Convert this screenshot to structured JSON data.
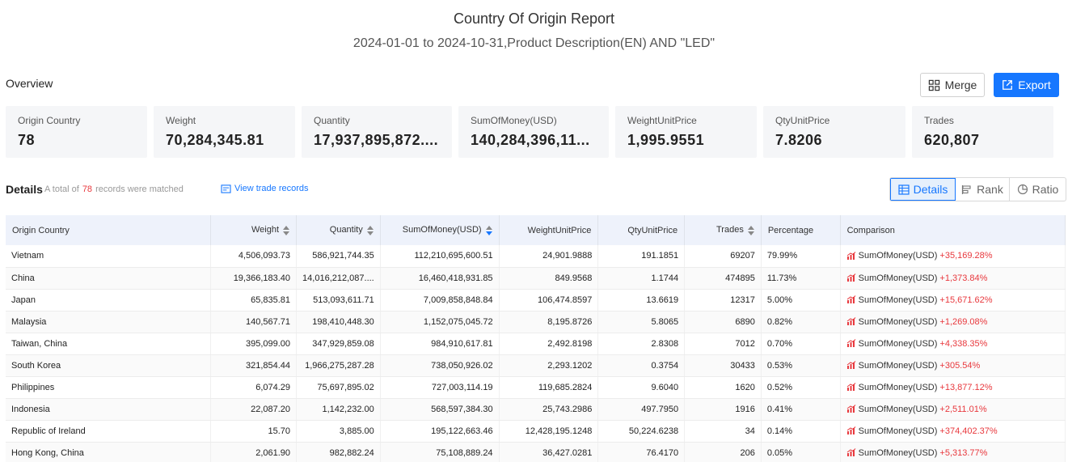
{
  "report": {
    "title": "Country Of Origin Report",
    "subtitle": "2024-01-01 to 2024-10-31,Product Description(EN) AND \"LED\""
  },
  "overview": {
    "label": "Overview",
    "merge_label": "Merge",
    "export_label": "Export",
    "stats": [
      {
        "label": "Origin Country",
        "value": "78"
      },
      {
        "label": "Weight",
        "value": "70,284,345.81"
      },
      {
        "label": "Quantity",
        "value": "17,937,895,872...."
      },
      {
        "label": "SumOfMoney(USD)",
        "value": "140,284,396,11..."
      },
      {
        "label": "WeightUnitPrice",
        "value": "1,995.9551"
      },
      {
        "label": "QtyUnitPrice",
        "value": "7.8206"
      },
      {
        "label": "Trades",
        "value": "620,807"
      }
    ]
  },
  "details": {
    "label": "Details",
    "note_prefix": "A total of",
    "count": "78",
    "note_suffix": "records were matched",
    "view_trade_label": "View trade records",
    "toggles": [
      "Details",
      "Rank",
      "Ratio"
    ]
  },
  "table": {
    "headers": [
      "Origin Country",
      "Weight",
      "Quantity",
      "SumOfMoney(USD)",
      "WeightUnitPrice",
      "QtyUnitPrice",
      "Trades",
      "Percentage",
      "Comparison"
    ],
    "rows": [
      [
        "Vietnam",
        "4,506,093.73",
        "586,921,744.35",
        "112,210,695,600.51",
        "24,901.9888",
        "191.1851",
        "69207",
        "79.99%",
        "SumOfMoney(USD)",
        "+35,169.28%"
      ],
      [
        "China",
        "19,366,183.40",
        "14,016,212,087....",
        "16,460,418,931.85",
        "849.9568",
        "1.1744",
        "474895",
        "11.73%",
        "SumOfMoney(USD)",
        "+1,373.84%"
      ],
      [
        "Japan",
        "65,835.81",
        "513,093,611.71",
        "7,009,858,848.84",
        "106,474.8597",
        "13.6619",
        "12317",
        "5.00%",
        "SumOfMoney(USD)",
        "+15,671.62%"
      ],
      [
        "Malaysia",
        "140,567.71",
        "198,410,448.30",
        "1,152,075,045.72",
        "8,195.8726",
        "5.8065",
        "6890",
        "0.82%",
        "SumOfMoney(USD)",
        "+1,269.08%"
      ],
      [
        "Taiwan, China",
        "395,099.00",
        "347,929,859.08",
        "984,910,617.81",
        "2,492.8198",
        "2.8308",
        "7012",
        "0.70%",
        "SumOfMoney(USD)",
        "+4,338.35%"
      ],
      [
        "South Korea",
        "321,854.44",
        "1,966,275,287.28",
        "738,050,926.02",
        "2,293.1202",
        "0.3754",
        "30433",
        "0.53%",
        "SumOfMoney(USD)",
        "+305.54%"
      ],
      [
        "Philippines",
        "6,074.29",
        "75,697,895.02",
        "727,003,114.19",
        "119,685.2824",
        "9.6040",
        "1620",
        "0.52%",
        "SumOfMoney(USD)",
        "+13,877.12%"
      ],
      [
        "Indonesia",
        "22,087.20",
        "1,142,232.00",
        "568,597,384.30",
        "25,743.2986",
        "497.7950",
        "1916",
        "0.41%",
        "SumOfMoney(USD)",
        "+2,511.01%"
      ],
      [
        "Republic of Ireland",
        "15.70",
        "3,885.00",
        "195,122,663.46",
        "12,428,195.1248",
        "50,224.6238",
        "34",
        "0.14%",
        "SumOfMoney(USD)",
        "+374,402.37%"
      ],
      [
        "Hong Kong, China",
        "2,061.90",
        "982,882.24",
        "75,108,889.24",
        "36,427.0281",
        "76.4170",
        "206",
        "0.05%",
        "SumOfMoney(USD)",
        "+5,313.77%"
      ]
    ]
  },
  "colors": {
    "accent": "#1677ff",
    "positive_change": "#e8383d",
    "card_bg": "#f5f6f8",
    "header_bg": "#eef2fb"
  },
  "icons": {
    "merge": "merge-icon",
    "export": "export-icon",
    "view_trade": "view-trade-icon",
    "details": "table-icon",
    "rank": "bar-rank-icon",
    "ratio": "pie-icon",
    "comparison": "trend-chart-icon",
    "sort": "sort-icon"
  }
}
